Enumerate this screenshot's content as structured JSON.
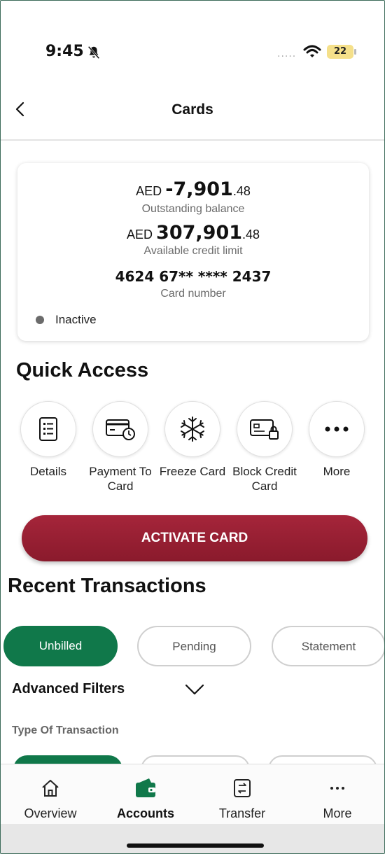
{
  "status_bar": {
    "time": "9:45",
    "battery": "22",
    "signal": "....."
  },
  "header": {
    "title": "Cards"
  },
  "card": {
    "outstanding": {
      "currency": "AED",
      "integer": "-7,901",
      "decimal": ".48",
      "label": "Outstanding balance"
    },
    "available": {
      "currency": "AED",
      "integer": "307,901",
      "decimal": ".48",
      "label": "Available credit limit"
    },
    "card_number": "4624 67** **** 2437",
    "card_number_label": "Card number",
    "status": "Inactive"
  },
  "quick_access": {
    "title": "Quick Access",
    "items": [
      {
        "label": "Details",
        "icon": "document-icon"
      },
      {
        "label": "Payment To Card",
        "icon": "card-clock-icon"
      },
      {
        "label": "Freeze Card",
        "icon": "snowflake-icon"
      },
      {
        "label": "Block Credit Card",
        "icon": "card-lock-icon"
      },
      {
        "label": "More",
        "icon": "more-dots-icon"
      }
    ]
  },
  "activate_button": "ACTIVATE CARD",
  "recent_transactions": {
    "title": "Recent Transactions",
    "tabs": [
      "Unbilled",
      "Pending",
      "Statement"
    ],
    "active_tab": "Unbilled",
    "advanced_filters": "Advanced Filters",
    "type_of_transaction": "Type Of Transaction"
  },
  "bottom_nav": {
    "items": [
      {
        "label": "Overview",
        "icon": "home-icon"
      },
      {
        "label": "Accounts",
        "icon": "wallet-icon"
      },
      {
        "label": "Transfer",
        "icon": "transfer-icon"
      },
      {
        "label": "More",
        "icon": "more-dots-icon"
      }
    ],
    "active": "Accounts"
  },
  "colors": {
    "brand_green": "#10784a",
    "activate_red": "#9a1f33",
    "status_gray": "#6b6b6b"
  }
}
